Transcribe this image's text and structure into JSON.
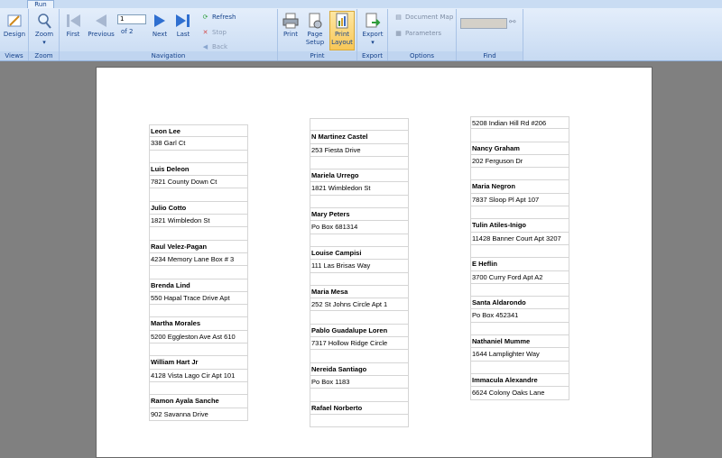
{
  "tab": {
    "label": "Run"
  },
  "ribbon": {
    "views": {
      "label": "Views",
      "design": "Design"
    },
    "zoom": {
      "label": "Zoom",
      "zoom": "Zoom"
    },
    "navigation": {
      "label": "Navigation",
      "first": "First",
      "previous": "Previous",
      "page_value": "1",
      "of_text": "of  2",
      "next": "Next",
      "last": "Last",
      "refresh": "Refresh",
      "stop": "Stop",
      "back": "Back"
    },
    "print": {
      "label": "Print",
      "print": "Print",
      "page_setup_1": "Page",
      "page_setup_2": "Setup",
      "print_layout_1": "Print",
      "print_layout_2": "Layout"
    },
    "export": {
      "label": "Export",
      "export": "Export"
    },
    "options": {
      "label": "Options",
      "document_map": "Document Map",
      "parameters": "Parameters"
    },
    "find": {
      "label": "Find"
    }
  },
  "report": {
    "col1": [
      [
        "Leon Lee",
        "338 Garl Ct"
      ],
      [
        "Luis Deleon",
        "7821 County Down Ct"
      ],
      [
        "Julio Cotto",
        "1821 Wimbledon St"
      ],
      [
        "Raul Velez-Pagan",
        "4234 Memory Lane Box # 3"
      ],
      [
        "Brenda Lind",
        "550 Hapal Trace Drive Apt"
      ],
      [
        "Martha Morales",
        "5200 Eggleston Ave Ast 610"
      ],
      [
        "William Hart Jr",
        "4128 Vista Lago Cir Apt 101"
      ],
      [
        "Ramon Ayala Sanche",
        "902 Savanna Drive"
      ]
    ],
    "col2": [
      [
        "N Martinez Castel",
        "253 Fiesta Drive"
      ],
      [
        "Mariela Urrego",
        "1821 Wimbledon St"
      ],
      [
        "Mary Peters",
        "Po Box 681314"
      ],
      [
        "Louise Campisi",
        "111 Las Brisas Way"
      ],
      [
        "Maria Mesa",
        "252 St Johns Circle Apt 1"
      ],
      [
        "Pablo Guadalupe Loren",
        "7317 Hollow Ridge Circle"
      ],
      [
        "Nereida Santiago",
        "Po Box 1183"
      ],
      [
        "Rafael Norberto",
        ""
      ]
    ],
    "col3_top": "5208 Indian Hill Rd #206",
    "col3": [
      [
        "Nancy Graham",
        "202 Ferguson Dr"
      ],
      [
        "Maria Negron",
        "7837 Sloop Pl Apt 107"
      ],
      [
        "Tulin Atiles-Inigo",
        "11428 Banner Court Apt 3207"
      ],
      [
        "E Heflin",
        "3700 Curry Ford Apt A2"
      ],
      [
        "Santa Aldarondo",
        "Po Box 452341"
      ],
      [
        "Nathaniel Mumme",
        "1644 Lamplighter Way"
      ],
      [
        "Immacula Alexandre",
        "6624 Colony Oaks Lane"
      ]
    ]
  }
}
